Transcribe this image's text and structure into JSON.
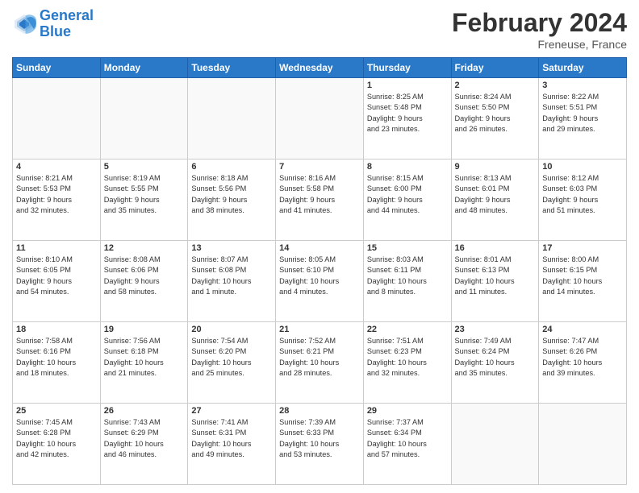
{
  "header": {
    "logo_line1": "General",
    "logo_line2": "Blue",
    "month_year": "February 2024",
    "location": "Freneuse, France"
  },
  "weekdays": [
    "Sunday",
    "Monday",
    "Tuesday",
    "Wednesday",
    "Thursday",
    "Friday",
    "Saturday"
  ],
  "weeks": [
    [
      {
        "day": "",
        "info": ""
      },
      {
        "day": "",
        "info": ""
      },
      {
        "day": "",
        "info": ""
      },
      {
        "day": "",
        "info": ""
      },
      {
        "day": "1",
        "info": "Sunrise: 8:25 AM\nSunset: 5:48 PM\nDaylight: 9 hours\nand 23 minutes."
      },
      {
        "day": "2",
        "info": "Sunrise: 8:24 AM\nSunset: 5:50 PM\nDaylight: 9 hours\nand 26 minutes."
      },
      {
        "day": "3",
        "info": "Sunrise: 8:22 AM\nSunset: 5:51 PM\nDaylight: 9 hours\nand 29 minutes."
      }
    ],
    [
      {
        "day": "4",
        "info": "Sunrise: 8:21 AM\nSunset: 5:53 PM\nDaylight: 9 hours\nand 32 minutes."
      },
      {
        "day": "5",
        "info": "Sunrise: 8:19 AM\nSunset: 5:55 PM\nDaylight: 9 hours\nand 35 minutes."
      },
      {
        "day": "6",
        "info": "Sunrise: 8:18 AM\nSunset: 5:56 PM\nDaylight: 9 hours\nand 38 minutes."
      },
      {
        "day": "7",
        "info": "Sunrise: 8:16 AM\nSunset: 5:58 PM\nDaylight: 9 hours\nand 41 minutes."
      },
      {
        "day": "8",
        "info": "Sunrise: 8:15 AM\nSunset: 6:00 PM\nDaylight: 9 hours\nand 44 minutes."
      },
      {
        "day": "9",
        "info": "Sunrise: 8:13 AM\nSunset: 6:01 PM\nDaylight: 9 hours\nand 48 minutes."
      },
      {
        "day": "10",
        "info": "Sunrise: 8:12 AM\nSunset: 6:03 PM\nDaylight: 9 hours\nand 51 minutes."
      }
    ],
    [
      {
        "day": "11",
        "info": "Sunrise: 8:10 AM\nSunset: 6:05 PM\nDaylight: 9 hours\nand 54 minutes."
      },
      {
        "day": "12",
        "info": "Sunrise: 8:08 AM\nSunset: 6:06 PM\nDaylight: 9 hours\nand 58 minutes."
      },
      {
        "day": "13",
        "info": "Sunrise: 8:07 AM\nSunset: 6:08 PM\nDaylight: 10 hours\nand 1 minute."
      },
      {
        "day": "14",
        "info": "Sunrise: 8:05 AM\nSunset: 6:10 PM\nDaylight: 10 hours\nand 4 minutes."
      },
      {
        "day": "15",
        "info": "Sunrise: 8:03 AM\nSunset: 6:11 PM\nDaylight: 10 hours\nand 8 minutes."
      },
      {
        "day": "16",
        "info": "Sunrise: 8:01 AM\nSunset: 6:13 PM\nDaylight: 10 hours\nand 11 minutes."
      },
      {
        "day": "17",
        "info": "Sunrise: 8:00 AM\nSunset: 6:15 PM\nDaylight: 10 hours\nand 14 minutes."
      }
    ],
    [
      {
        "day": "18",
        "info": "Sunrise: 7:58 AM\nSunset: 6:16 PM\nDaylight: 10 hours\nand 18 minutes."
      },
      {
        "day": "19",
        "info": "Sunrise: 7:56 AM\nSunset: 6:18 PM\nDaylight: 10 hours\nand 21 minutes."
      },
      {
        "day": "20",
        "info": "Sunrise: 7:54 AM\nSunset: 6:20 PM\nDaylight: 10 hours\nand 25 minutes."
      },
      {
        "day": "21",
        "info": "Sunrise: 7:52 AM\nSunset: 6:21 PM\nDaylight: 10 hours\nand 28 minutes."
      },
      {
        "day": "22",
        "info": "Sunrise: 7:51 AM\nSunset: 6:23 PM\nDaylight: 10 hours\nand 32 minutes."
      },
      {
        "day": "23",
        "info": "Sunrise: 7:49 AM\nSunset: 6:24 PM\nDaylight: 10 hours\nand 35 minutes."
      },
      {
        "day": "24",
        "info": "Sunrise: 7:47 AM\nSunset: 6:26 PM\nDaylight: 10 hours\nand 39 minutes."
      }
    ],
    [
      {
        "day": "25",
        "info": "Sunrise: 7:45 AM\nSunset: 6:28 PM\nDaylight: 10 hours\nand 42 minutes."
      },
      {
        "day": "26",
        "info": "Sunrise: 7:43 AM\nSunset: 6:29 PM\nDaylight: 10 hours\nand 46 minutes."
      },
      {
        "day": "27",
        "info": "Sunrise: 7:41 AM\nSunset: 6:31 PM\nDaylight: 10 hours\nand 49 minutes."
      },
      {
        "day": "28",
        "info": "Sunrise: 7:39 AM\nSunset: 6:33 PM\nDaylight: 10 hours\nand 53 minutes."
      },
      {
        "day": "29",
        "info": "Sunrise: 7:37 AM\nSunset: 6:34 PM\nDaylight: 10 hours\nand 57 minutes."
      },
      {
        "day": "",
        "info": ""
      },
      {
        "day": "",
        "info": ""
      }
    ]
  ]
}
